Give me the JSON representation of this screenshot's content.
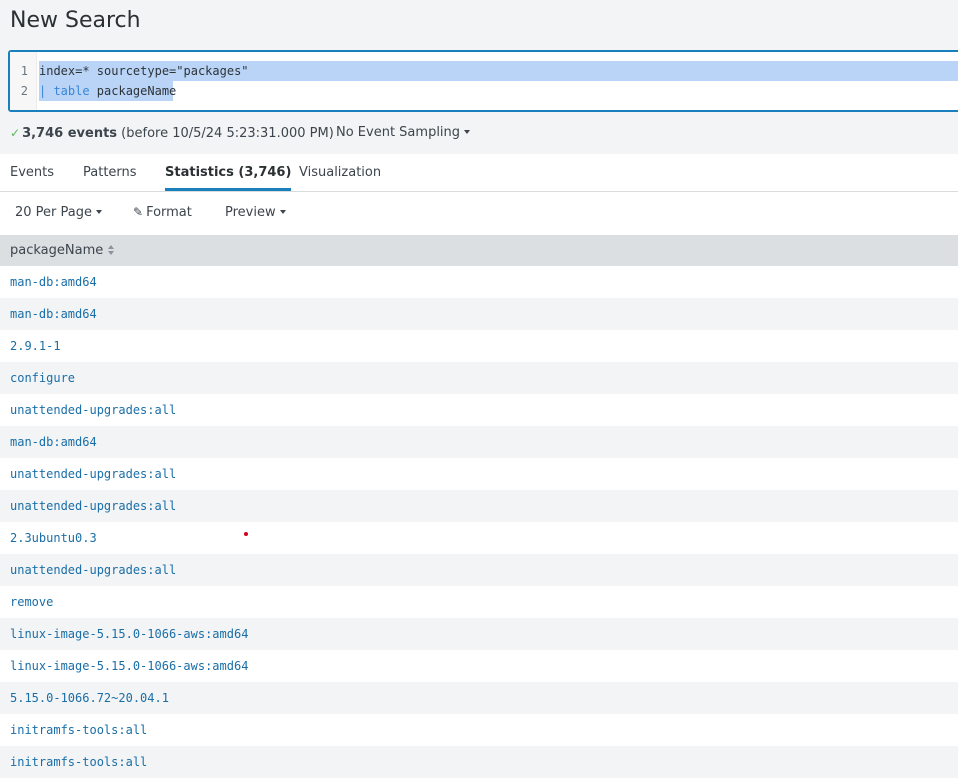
{
  "page": {
    "title": "New Search"
  },
  "search": {
    "lines": [
      {
        "number": "1",
        "text": "index=* sourcetype=\"packages\""
      },
      {
        "number": "2",
        "pipe": "| ",
        "keyword": "table",
        "rest": " packageName"
      }
    ]
  },
  "status": {
    "check_icon": "check-icon",
    "count": "3,746 events",
    "detail": "(before 10/5/24 5:23:31.000 PM)",
    "sampling": "No Event Sampling"
  },
  "tabs": [
    {
      "label": "Events",
      "active": false
    },
    {
      "label": "Patterns",
      "active": false
    },
    {
      "label": "Statistics (3,746)",
      "active": true
    },
    {
      "label": "Visualization",
      "active": false
    }
  ],
  "toolbar": {
    "per_page": "20 Per Page",
    "format": "Format",
    "format_icon": "pencil-icon",
    "preview": "Preview"
  },
  "table": {
    "column": "packageName",
    "rows": [
      "man-db:amd64",
      "man-db:amd64",
      "2.9.1-1",
      "configure",
      "unattended-upgrades:all",
      "man-db:amd64",
      "unattended-upgrades:all",
      "unattended-upgrades:all",
      "2.3ubuntu0.3",
      "unattended-upgrades:all",
      "remove",
      "linux-image-5.15.0-1066-aws:amd64",
      "linux-image-5.15.0-1066-aws:amd64",
      "5.15.0-1066.72~20.04.1",
      "initramfs-tools:all",
      "initramfs-tools:all"
    ]
  },
  "colors": {
    "accent": "#1a7fbd",
    "link": "#1a6ea8",
    "selection": "#b9d4f7",
    "success": "#5cb85c",
    "marker": "#d0021b"
  }
}
